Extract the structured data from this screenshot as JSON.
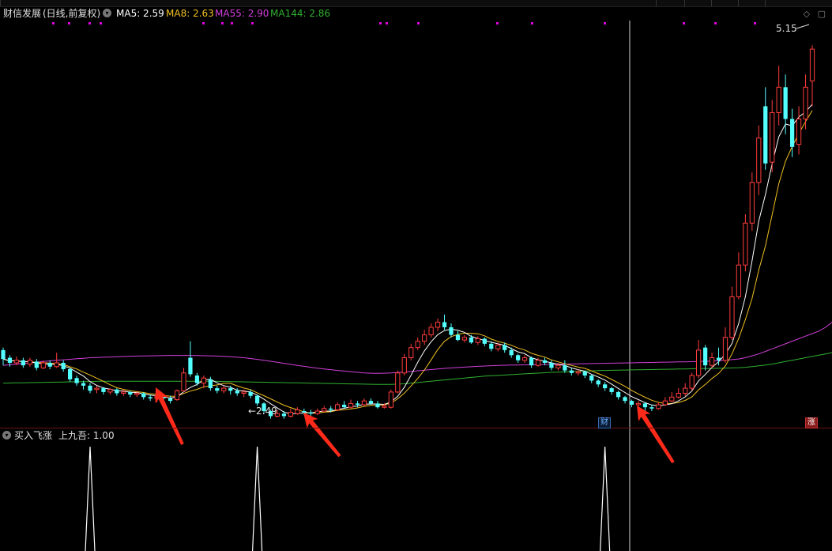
{
  "window": {
    "toolbar_items": [
      "",
      "",
      "",
      "",
      "",
      ""
    ]
  },
  "header": {
    "stock_name": "财信发展",
    "period_info": "(日线,前复权)",
    "ma": [
      {
        "label": "MA5: 2.59",
        "color": "#ffffff"
      },
      {
        "label": "MA8: 2.63",
        "color": "#f0c020"
      },
      {
        "label": "MA55: 2.90",
        "color": "#d040d8"
      },
      {
        "label": "MA144: 2.86",
        "color": "#30b030"
      }
    ]
  },
  "indicator": {
    "name": "买入飞涨",
    "value_label": "上九吾: 1.00"
  },
  "badges": {
    "cai": "财",
    "zhang": "涨"
  },
  "annotations": {
    "low_price": "2.49",
    "high_price": "5.15"
  },
  "colors": {
    "up": "#ff3c3c",
    "down": "#54ffff",
    "ma5": "#ffffff",
    "ma8": "#f0c020",
    "ma55": "#d040d8",
    "ma144": "#30b030",
    "arrow": "#ff2a1a",
    "marker": "#e000e0"
  },
  "chart_data": {
    "type": "candlestick",
    "ylim": [
      2.3,
      5.35
    ],
    "candles": [
      [
        2.78,
        2.71,
        2.8,
        2.66
      ],
      [
        2.72,
        2.68,
        2.74,
        2.65
      ],
      [
        2.68,
        2.7,
        2.73,
        2.66
      ],
      [
        2.7,
        2.66,
        2.72,
        2.64
      ],
      [
        2.67,
        2.7,
        2.72,
        2.65
      ],
      [
        2.69,
        2.64,
        2.71,
        2.62
      ],
      [
        2.64,
        2.68,
        2.7,
        2.63
      ],
      [
        2.68,
        2.65,
        2.7,
        2.63
      ],
      [
        2.65,
        2.68,
        2.76,
        2.64
      ],
      [
        2.68,
        2.63,
        2.7,
        2.61
      ],
      [
        2.63,
        2.55,
        2.64,
        2.53
      ],
      [
        2.56,
        2.52,
        2.58,
        2.5
      ],
      [
        2.52,
        2.5,
        2.54,
        2.47
      ],
      [
        2.5,
        2.46,
        2.52,
        2.44
      ],
      [
        2.47,
        2.48,
        2.5,
        2.44
      ],
      [
        2.48,
        2.45,
        2.49,
        2.43
      ],
      [
        2.45,
        2.47,
        2.48,
        2.43
      ],
      [
        2.47,
        2.44,
        2.48,
        2.42
      ],
      [
        2.44,
        2.45,
        2.47,
        2.42
      ],
      [
        2.45,
        2.43,
        2.46,
        2.41
      ],
      [
        2.43,
        2.44,
        2.46,
        2.41
      ],
      [
        2.44,
        2.41,
        2.45,
        2.39
      ],
      [
        2.41,
        2.4,
        2.43,
        2.38
      ],
      [
        2.4,
        2.42,
        2.44,
        2.37
      ],
      [
        2.42,
        2.4,
        2.43,
        2.38
      ],
      [
        2.4,
        2.38,
        2.42,
        2.36
      ],
      [
        2.39,
        2.46,
        2.47,
        2.38
      ],
      [
        2.46,
        2.6,
        2.64,
        2.45
      ],
      [
        2.72,
        2.59,
        2.85,
        2.57
      ],
      [
        2.58,
        2.52,
        2.6,
        2.5
      ],
      [
        2.52,
        2.56,
        2.58,
        2.48
      ],
      [
        2.55,
        2.48,
        2.57,
        2.46
      ],
      [
        2.48,
        2.46,
        2.5,
        2.44
      ],
      [
        2.46,
        2.48,
        2.5,
        2.44
      ],
      [
        2.48,
        2.46,
        2.5,
        2.43
      ],
      [
        2.46,
        2.44,
        2.48,
        2.42
      ],
      [
        2.44,
        2.45,
        2.47,
        2.41
      ],
      [
        2.45,
        2.42,
        2.47,
        2.4
      ],
      [
        2.42,
        2.36,
        2.43,
        2.34
      ],
      [
        2.36,
        2.3,
        2.37,
        2.28
      ],
      [
        2.3,
        2.26,
        2.31,
        2.24
      ],
      [
        2.26,
        2.28,
        2.31,
        2.25
      ],
      [
        2.28,
        2.26,
        2.3,
        2.24
      ],
      [
        2.26,
        2.29,
        2.32,
        2.25
      ],
      [
        2.28,
        2.31,
        2.33,
        2.27
      ],
      [
        2.3,
        2.29,
        2.32,
        2.27
      ],
      [
        2.29,
        2.28,
        2.31,
        2.26
      ],
      [
        2.28,
        2.3,
        2.32,
        2.27
      ],
      [
        2.3,
        2.32,
        2.34,
        2.29
      ],
      [
        2.32,
        2.31,
        2.34,
        2.29
      ],
      [
        2.31,
        2.35,
        2.37,
        2.3
      ],
      [
        2.35,
        2.33,
        2.38,
        2.32
      ],
      [
        2.33,
        2.36,
        2.39,
        2.32
      ],
      [
        2.36,
        2.35,
        2.38,
        2.33
      ],
      [
        2.35,
        2.38,
        2.4,
        2.34
      ],
      [
        2.38,
        2.36,
        2.4,
        2.35
      ],
      [
        2.36,
        2.33,
        2.38,
        2.32
      ],
      [
        2.33,
        2.34,
        2.36,
        2.32
      ],
      [
        2.33,
        2.45,
        2.47,
        2.32
      ],
      [
        2.45,
        2.6,
        2.62,
        2.44
      ],
      [
        2.6,
        2.72,
        2.75,
        2.58
      ],
      [
        2.72,
        2.8,
        2.83,
        2.7
      ],
      [
        2.8,
        2.85,
        2.88,
        2.78
      ],
      [
        2.85,
        2.9,
        2.94,
        2.82
      ],
      [
        2.9,
        2.96,
        2.99,
        2.88
      ],
      [
        2.96,
        3.0,
        3.03,
        2.93
      ],
      [
        3.0,
        2.96,
        3.06,
        2.94
      ],
      [
        2.96,
        2.9,
        2.99,
        2.88
      ],
      [
        2.9,
        2.86,
        2.93,
        2.85
      ],
      [
        2.86,
        2.88,
        2.9,
        2.84
      ],
      [
        2.88,
        2.84,
        2.9,
        2.83
      ],
      [
        2.84,
        2.87,
        2.89,
        2.82
      ],
      [
        2.87,
        2.83,
        2.88,
        2.81
      ],
      [
        2.83,
        2.79,
        2.85,
        2.77
      ],
      [
        2.79,
        2.82,
        2.84,
        2.77
      ],
      [
        2.82,
        2.78,
        2.84,
        2.76
      ],
      [
        2.78,
        2.74,
        2.8,
        2.72
      ],
      [
        2.74,
        2.7,
        2.75,
        2.68
      ],
      [
        2.7,
        2.72,
        2.74,
        2.68
      ],
      [
        2.72,
        2.66,
        2.73,
        2.64
      ],
      [
        2.66,
        2.7,
        2.72,
        2.65
      ],
      [
        2.7,
        2.68,
        2.72,
        2.66
      ],
      [
        2.68,
        2.64,
        2.7,
        2.62
      ],
      [
        2.64,
        2.66,
        2.68,
        2.62
      ],
      [
        2.66,
        2.62,
        2.7,
        2.6
      ],
      [
        2.62,
        2.6,
        2.64,
        2.58
      ],
      [
        2.6,
        2.61,
        2.63,
        2.58
      ],
      [
        2.61,
        2.58,
        2.62,
        2.56
      ],
      [
        2.58,
        2.54,
        2.59,
        2.52
      ],
      [
        2.54,
        2.51,
        2.55,
        2.49
      ],
      [
        2.51,
        2.48,
        2.53,
        2.46
      ],
      [
        2.48,
        2.45,
        2.49,
        2.43
      ],
      [
        2.45,
        2.41,
        2.46,
        2.39
      ],
      [
        2.41,
        2.38,
        2.42,
        2.36
      ],
      [
        2.38,
        2.35,
        2.39,
        2.33
      ],
      [
        2.35,
        2.36,
        2.38,
        2.32
      ],
      [
        2.36,
        2.33,
        2.37,
        2.3
      ],
      [
        2.33,
        2.32,
        2.35,
        2.3
      ],
      [
        2.32,
        2.35,
        2.37,
        2.31
      ],
      [
        2.35,
        2.38,
        2.41,
        2.34
      ],
      [
        2.38,
        2.41,
        2.45,
        2.37
      ],
      [
        2.41,
        2.44,
        2.48,
        2.4
      ],
      [
        2.44,
        2.48,
        2.52,
        2.42
      ],
      [
        2.48,
        2.58,
        2.6,
        2.46
      ],
      [
        2.58,
        2.78,
        2.86,
        2.56
      ],
      [
        2.8,
        2.66,
        2.82,
        2.62
      ],
      [
        2.66,
        2.72,
        2.76,
        2.64
      ],
      [
        2.72,
        2.7,
        2.8,
        2.66
      ],
      [
        2.7,
        2.88,
        2.96,
        2.68
      ],
      [
        2.88,
        3.2,
        3.28,
        2.86
      ],
      [
        3.2,
        3.45,
        3.55,
        3.18
      ],
      [
        3.45,
        3.78,
        3.85,
        3.4
      ],
      [
        3.78,
        4.1,
        4.18,
        3.72
      ],
      [
        4.1,
        4.45,
        4.55,
        4.0
      ],
      [
        4.7,
        4.25,
        4.85,
        4.2
      ],
      [
        4.26,
        4.65,
        4.75,
        4.18
      ],
      [
        4.65,
        4.85,
        5.02,
        4.55
      ],
      [
        4.85,
        4.6,
        4.95,
        4.48
      ],
      [
        4.6,
        4.38,
        4.68,
        4.3
      ],
      [
        4.4,
        4.6,
        4.7,
        4.32
      ],
      [
        4.6,
        4.85,
        4.95,
        4.52
      ],
      [
        4.9,
        5.15,
        5.18,
        4.7
      ]
    ],
    "ma55": [
      2.66,
      2.665,
      2.67,
      2.675,
      2.68,
      2.685,
      2.69,
      2.695,
      2.7,
      2.704,
      2.708,
      2.712,
      2.716,
      2.72,
      2.722,
      2.724,
      2.726,
      2.728,
      2.73,
      2.732,
      2.733,
      2.734,
      2.735,
      2.736,
      2.737,
      2.738,
      2.738,
      2.738,
      2.738,
      2.737,
      2.736,
      2.735,
      2.733,
      2.731,
      2.728,
      2.724,
      2.72,
      2.714,
      2.707,
      2.7,
      2.692,
      2.684,
      2.676,
      2.668,
      2.66,
      2.652,
      2.645,
      2.638,
      2.632,
      2.626,
      2.62,
      2.615,
      2.61,
      2.605,
      2.6,
      2.598,
      2.597,
      2.598,
      2.6,
      2.604,
      2.608,
      2.612,
      2.617,
      2.622,
      2.627,
      2.632,
      2.636,
      2.64,
      2.643,
      2.646,
      2.649,
      2.652,
      2.655,
      2.657,
      2.659,
      2.661,
      2.662,
      2.663,
      2.664,
      2.665,
      2.666,
      2.667,
      2.668,
      2.669,
      2.67,
      2.671,
      2.672,
      2.673,
      2.674,
      2.675,
      2.676,
      2.677,
      2.678,
      2.679,
      2.68,
      2.681,
      2.682,
      2.683,
      2.684,
      2.685,
      2.686,
      2.687,
      2.688,
      2.689,
      2.69,
      2.692,
      2.694,
      2.697,
      2.7,
      2.705,
      2.71,
      2.72,
      2.735,
      2.75,
      2.77,
      2.79,
      2.81,
      2.83,
      2.85,
      2.87,
      2.89,
      2.91,
      2.93,
      2.96,
      3.0
    ],
    "ma144": [
      2.52,
      2.521,
      2.522,
      2.523,
      2.524,
      2.525,
      2.526,
      2.527,
      2.528,
      2.529,
      2.53,
      2.531,
      2.532,
      2.533,
      2.534,
      2.535,
      2.535,
      2.535,
      2.535,
      2.535,
      2.535,
      2.535,
      2.535,
      2.535,
      2.535,
      2.535,
      2.535,
      2.535,
      2.535,
      2.535,
      2.535,
      2.535,
      2.534,
      2.533,
      2.532,
      2.531,
      2.53,
      2.529,
      2.528,
      2.527,
      2.526,
      2.525,
      2.524,
      2.523,
      2.522,
      2.521,
      2.52,
      2.519,
      2.518,
      2.517,
      2.516,
      2.515,
      2.514,
      2.513,
      2.512,
      2.511,
      2.51,
      2.51,
      2.51,
      2.512,
      2.515,
      2.52,
      2.525,
      2.53,
      2.535,
      2.54,
      2.545,
      2.55,
      2.555,
      2.56,
      2.565,
      2.57,
      2.575,
      2.578,
      2.581,
      2.584,
      2.587,
      2.59,
      2.593,
      2.596,
      2.599,
      2.602,
      2.605,
      2.607,
      2.609,
      2.611,
      2.613,
      2.615,
      2.617,
      2.619,
      2.62,
      2.621,
      2.622,
      2.623,
      2.624,
      2.625,
      2.626,
      2.627,
      2.628,
      2.629,
      2.63,
      2.631,
      2.632,
      2.633,
      2.634,
      2.635,
      2.636,
      2.637,
      2.638,
      2.64,
      2.642,
      2.645,
      2.65,
      2.656,
      2.662,
      2.67,
      2.68,
      2.69,
      2.7,
      2.71,
      2.72,
      2.73,
      2.74,
      2.75,
      2.76
    ],
    "markers": [
      13,
      38,
      90
    ],
    "indicator_spikes": [
      13,
      38,
      90
    ]
  }
}
